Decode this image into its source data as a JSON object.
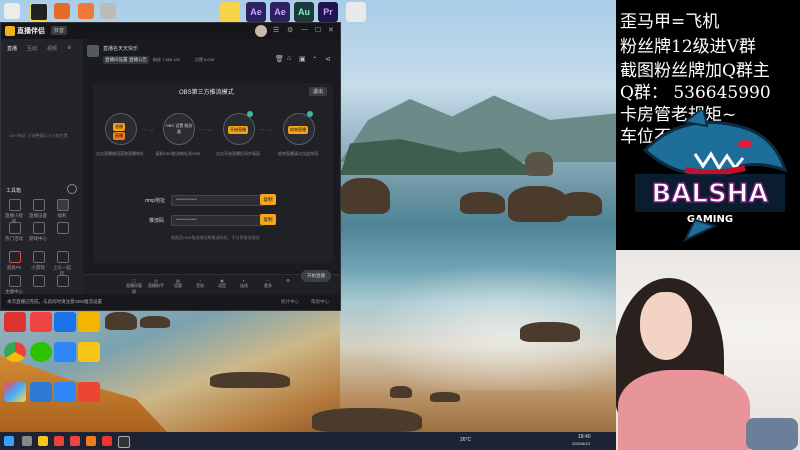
{
  "app": {
    "title": "直播伴侣",
    "version": "抖音",
    "sidebar_tabs": [
      "直播",
      "互动",
      "视频"
    ],
    "sidebar_hint": "Ctrl+拖动, 可调整窗口大小和位置",
    "tools": [
      "工具箱",
      "直播小程序",
      "直播设置",
      "福利",
      "热门活动",
      "游戏中心",
      "道具PK",
      "小游戏",
      "上头一起玩",
      "主播中心"
    ],
    "room_title": "直播名天天快乐",
    "room_tags": [
      "直播间设置",
      "直播公告",
      "主播小程序"
    ],
    "room_stats": [
      "粉丝  7,580,100",
      "点赞  6,035"
    ],
    "mode_title": "OBS第三方推流模式",
    "exit_label": "退出",
    "steps": [
      {
        "btn": "直播",
        "caption": "点击直播按钮获取直播地址"
      },
      {
        "btn": "",
        "caption": "复制OBS推流地址到OBS"
      },
      {
        "btn": "开始直播",
        "caption": "点击开始直播后同步画面"
      },
      {
        "btn": "结束直播",
        "caption": "结束直播请点击此按钮"
      }
    ],
    "step_labels": [
      "OBS 设置 服务器"
    ],
    "fields": [
      {
        "label": "rtmp地址",
        "value": "••••••••••••",
        "btn": "复制"
      },
      {
        "label": "推流码",
        "value": "••••••••••••",
        "btn": "复制"
      }
    ],
    "hint": "粘贴至OBS推流地址和推流码处，不分享推流地址",
    "toolbar": [
      "直播间管理",
      "直播助手",
      "话题",
      "音效",
      "语音",
      "连线",
      "更多"
    ],
    "start_label": "开始直播",
    "status_text": "本次直播已完成，与此同时请注意OBS推流设置",
    "status_right": [
      "统计中心",
      "帮助中心"
    ]
  },
  "desktop_top_icons": [
    "Ae",
    "Ae",
    "Au",
    "Pr"
  ],
  "desktop_top_colors": [
    "#f5d44a",
    "#2c2261",
    "#2c2261",
    "#1b3a3a",
    "#1d1450"
  ],
  "taskbar": {
    "weather": "26°C",
    "time": "18:40",
    "date": "2022/6/13"
  },
  "overlay_lines": [
    "歪马甲=飞机",
    "粉丝牌12级进V群",
    "截图粉丝牌加Q群主",
    "Q群：  536645990",
    "卡房管老规矩~",
    "车位不给嫖哼"
  ],
  "mascot": {
    "word1": "BALSHA",
    "word2": "GAMING"
  }
}
